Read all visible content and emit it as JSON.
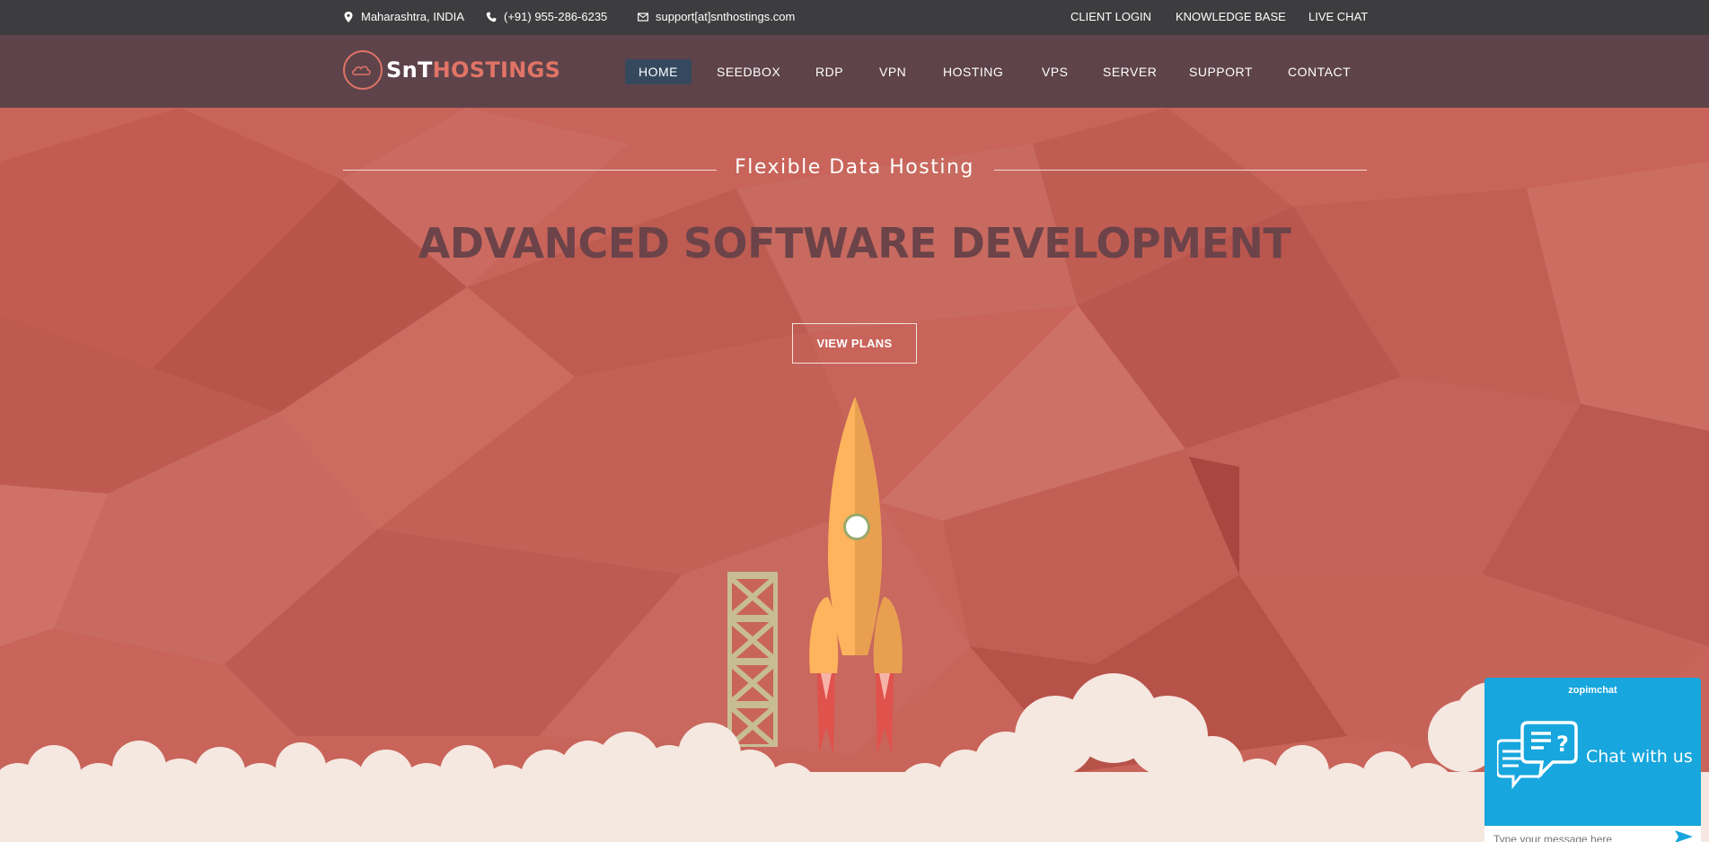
{
  "topbar": {
    "location": "Maharashtra, INDIA",
    "phone": "(+91) 955-286-6235",
    "email": "support[at]snthostings.com",
    "links": [
      "CLIENT LOGIN",
      "KNOWLEDGE BASE",
      "LIVE CHAT"
    ],
    "icons": [
      "map-marker-icon",
      "phone-icon",
      "envelope-icon"
    ]
  },
  "logo": {
    "part1": "SnT",
    "part2": "HOSTINGS"
  },
  "nav": {
    "items": [
      "HOME",
      "SEEDBOX",
      "RDP",
      "VPN",
      "HOSTING",
      "VPS",
      "SERVER",
      "SUPPORT",
      "CONTACT"
    ],
    "active": "HOME"
  },
  "hero": {
    "subtitle": "Flexible Data Hosting",
    "headline": "ADVANCED SOFTWARE DEVELOPMENT",
    "cta": "VIEW PLANS"
  },
  "chat": {
    "brand": "zopimchat",
    "title": "Chat with us",
    "placeholder": "Type your message here"
  },
  "colors": {
    "topbar": "#3d3d3f",
    "nav": "#5e434a",
    "hero": "#c8645a",
    "accent": "#e07466",
    "active_nav": "#34495e",
    "chat": "#17a6dd",
    "rocket": "#fdb45c",
    "cloud": "#f5e8e1"
  }
}
